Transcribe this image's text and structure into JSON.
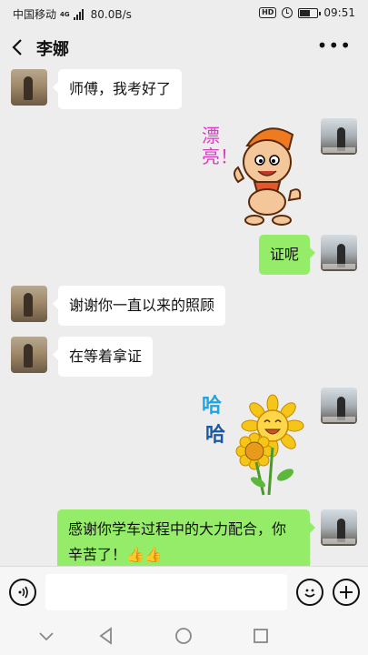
{
  "status_bar": {
    "carrier": "中国移动",
    "network": "4G",
    "speed": "80.0B/s",
    "hd": "HD",
    "time": "09:51",
    "battery_level": 0.6
  },
  "header": {
    "contact_name": "李娜",
    "more_icon": "more-icon"
  },
  "messages": [
    {
      "from": "them",
      "type": "text",
      "text": "师傅，我考好了"
    },
    {
      "from": "me",
      "type": "sticker",
      "sticker_text": "漂亮！"
    },
    {
      "from": "me",
      "type": "text",
      "text": "证呢"
    },
    {
      "from": "them",
      "type": "text",
      "text": "谢谢你一直以来的照顾"
    },
    {
      "from": "them",
      "type": "text",
      "text": "在等着拿证"
    },
    {
      "from": "me",
      "type": "sticker",
      "sticker_text_1": "哈",
      "sticker_text_2": "哈"
    },
    {
      "from": "me",
      "type": "text",
      "text": "感谢你学车过程中的大力配合，你辛苦了！👍👍"
    }
  ],
  "input_bar": {
    "placeholder": "",
    "voice_icon": "voice-icon",
    "emoji_icon": "emoji-icon",
    "plus_icon": "plus-icon"
  },
  "colors": {
    "background": "#ededed",
    "my_bubble": "#95ec69",
    "their_bubble": "#ffffff"
  }
}
